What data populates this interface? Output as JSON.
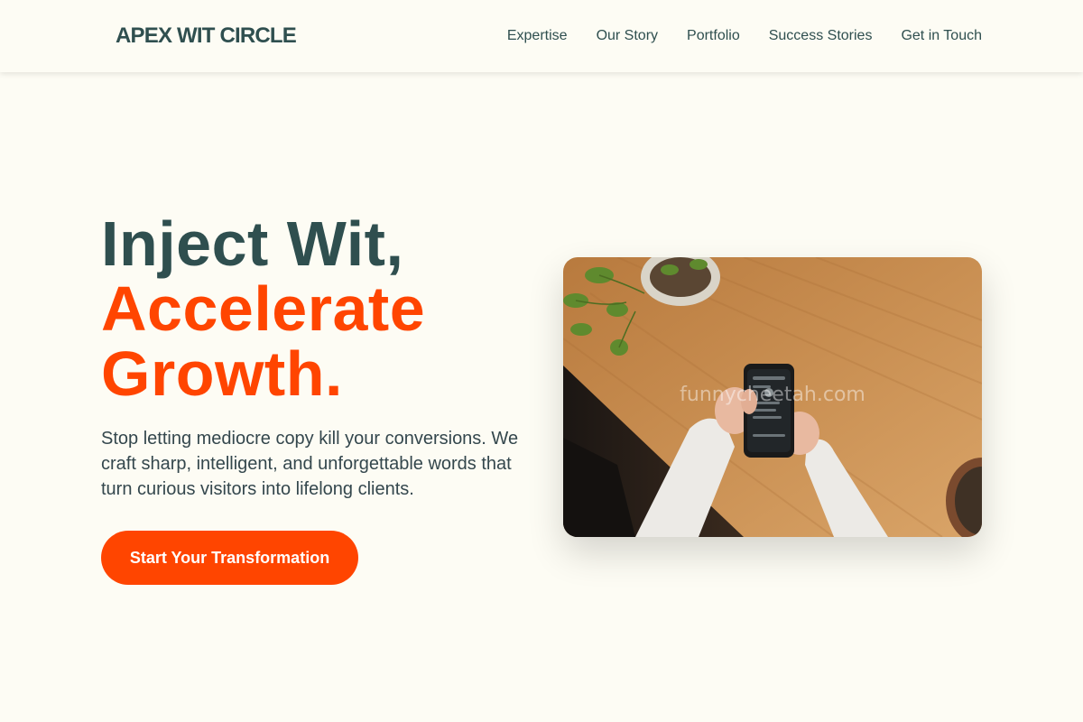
{
  "header": {
    "brand": "APEX WIT CIRCLE",
    "nav": [
      {
        "label": "Expertise"
      },
      {
        "label": "Our Story"
      },
      {
        "label": "Portfolio"
      },
      {
        "label": "Success Stories"
      },
      {
        "label": "Get in Touch"
      }
    ]
  },
  "hero": {
    "title_line1": "Inject Wit,",
    "title_line2": "Accelerate",
    "title_line3": "Growth.",
    "description": "Stop letting mediocre copy kill your conversions. We craft sharp, intelligent, and unforgettable words that turn curious visitors into lifelong clients.",
    "cta_label": "Start Your Transformation",
    "image": {
      "subject": "hands holding a smartphone over a wooden desk with potted plants",
      "watermark": "funnycheetah.com"
    }
  },
  "colors": {
    "background": "#fdfcf4",
    "text_dark": "#2f4f4f",
    "accent": "#ff4500"
  }
}
